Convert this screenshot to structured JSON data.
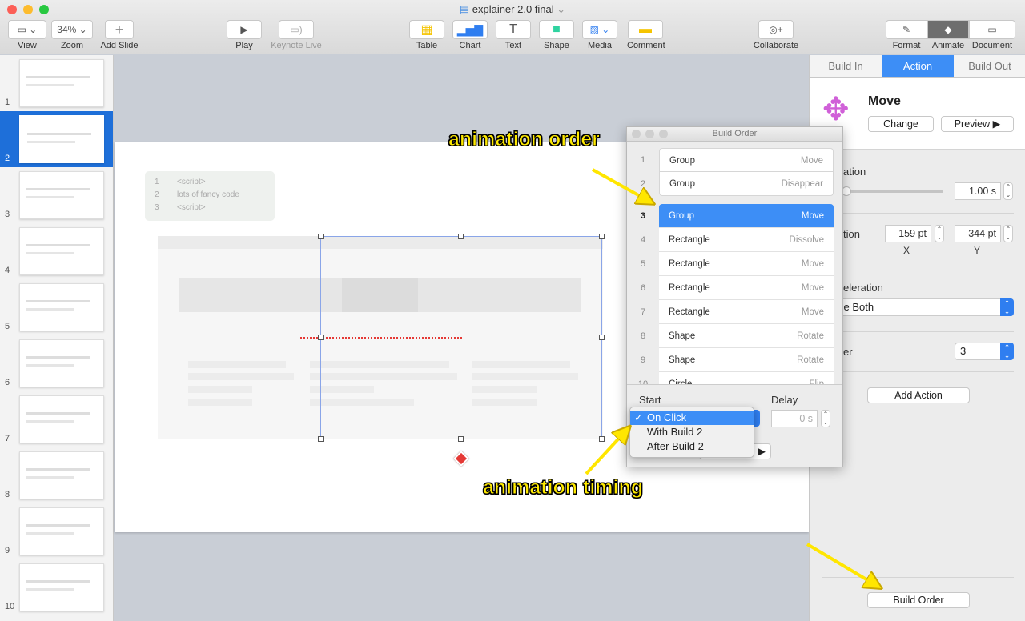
{
  "window": {
    "title": "explainer 2.0 final"
  },
  "toolbar": {
    "view": "View",
    "zoom_value": "34%",
    "zoom": "Zoom",
    "add_slide": "Add Slide",
    "play": "Play",
    "keynote_live": "Keynote Live",
    "table": "Table",
    "chart": "Chart",
    "text": "Text",
    "shape": "Shape",
    "media": "Media",
    "comment": "Comment",
    "collaborate": "Collaborate",
    "format": "Format",
    "animate": "Animate",
    "document": "Document"
  },
  "sidebar": {
    "slides": [
      "1",
      "2",
      "3",
      "4",
      "5",
      "6",
      "7",
      "8",
      "9",
      "10"
    ],
    "selected": "2"
  },
  "slide": {
    "code_lines": [
      {
        "n": "1",
        "t": "<script>"
      },
      {
        "n": "2",
        "t": "lots of fancy code"
      },
      {
        "n": "3",
        "t": "<script>"
      }
    ]
  },
  "panel": {
    "tabs": [
      "Build In",
      "Action",
      "Build Out"
    ],
    "active_tab": "Action",
    "effect": "Move",
    "change": "Change",
    "preview": "Preview",
    "duration_label": "ation",
    "duration": "1.00 s",
    "position_label": "tion",
    "x": "159 pt",
    "y": "344 pt",
    "x_label": "X",
    "y_label": "Y",
    "acceleration_label": "eleration",
    "acceleration": "se Both",
    "order_label": "er",
    "order": "3",
    "add_action": "Add Action",
    "build_order": "Build Order"
  },
  "build_order": {
    "title": "Build Order",
    "items": [
      {
        "n": "1",
        "name": "Group",
        "action": "Move"
      },
      {
        "n": "2",
        "name": "Group",
        "action": "Disappear"
      },
      {
        "n": "3",
        "name": "Group",
        "action": "Move"
      },
      {
        "n": "4",
        "name": "Rectangle",
        "action": "Dissolve"
      },
      {
        "n": "5",
        "name": "Rectangle",
        "action": "Move"
      },
      {
        "n": "6",
        "name": "Rectangle",
        "action": "Move"
      },
      {
        "n": "7",
        "name": "Rectangle",
        "action": "Move"
      },
      {
        "n": "8",
        "name": "Shape",
        "action": "Rotate"
      },
      {
        "n": "9",
        "name": "Shape",
        "action": "Rotate"
      },
      {
        "n": "10",
        "name": "Circle",
        "action": "Flip"
      }
    ],
    "selected": "3",
    "start_label": "Start",
    "delay_label": "Delay",
    "delay": "0 s",
    "start_options": [
      "On Click",
      "With Build 2",
      "After Build 2"
    ],
    "start_selected": "On Click"
  },
  "annotations": {
    "order": "animation order",
    "timing": "animation timing"
  },
  "colors": {
    "accent": "#3d8ef6",
    "annotation": "#ffea00",
    "move_icon": "#d060d8"
  }
}
